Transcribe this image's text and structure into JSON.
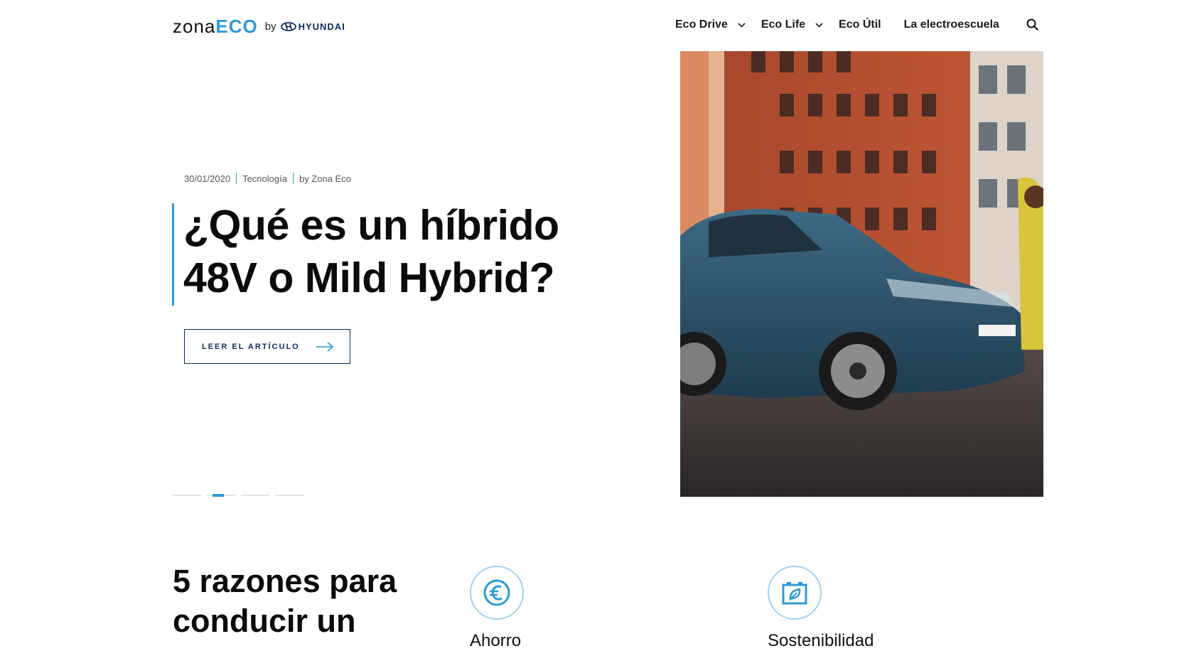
{
  "header": {
    "logo": {
      "zona": "zona",
      "eco": "ECO",
      "by": "by",
      "brand": "HYUNDAI"
    },
    "nav": [
      {
        "label": "Eco Drive",
        "has_dropdown": true
      },
      {
        "label": "Eco Life",
        "has_dropdown": true
      },
      {
        "label": "Eco Útil",
        "has_dropdown": false
      },
      {
        "label": "La electroescuela",
        "has_dropdown": false
      }
    ],
    "search_icon": "search-icon"
  },
  "hero": {
    "date": "30/01/2020",
    "category": "Tecnología",
    "author": "by Zona Eco",
    "title": "¿Qué es un híbrido 48V o Mild Hybrid?",
    "cta_label": "LEER EL ARTÍCULO",
    "slides_total": 4,
    "active_slide": 2
  },
  "reasons": {
    "title": "5 razones para conducir un",
    "items": [
      {
        "label": "Ahorro",
        "icon": "euro-icon"
      },
      {
        "label": "Sostenibilidad",
        "icon": "leaf-battery-icon"
      }
    ]
  },
  "colors": {
    "accent": "#2c9ad6",
    "navy": "#0b2a5a",
    "text": "#0b0b0b"
  }
}
